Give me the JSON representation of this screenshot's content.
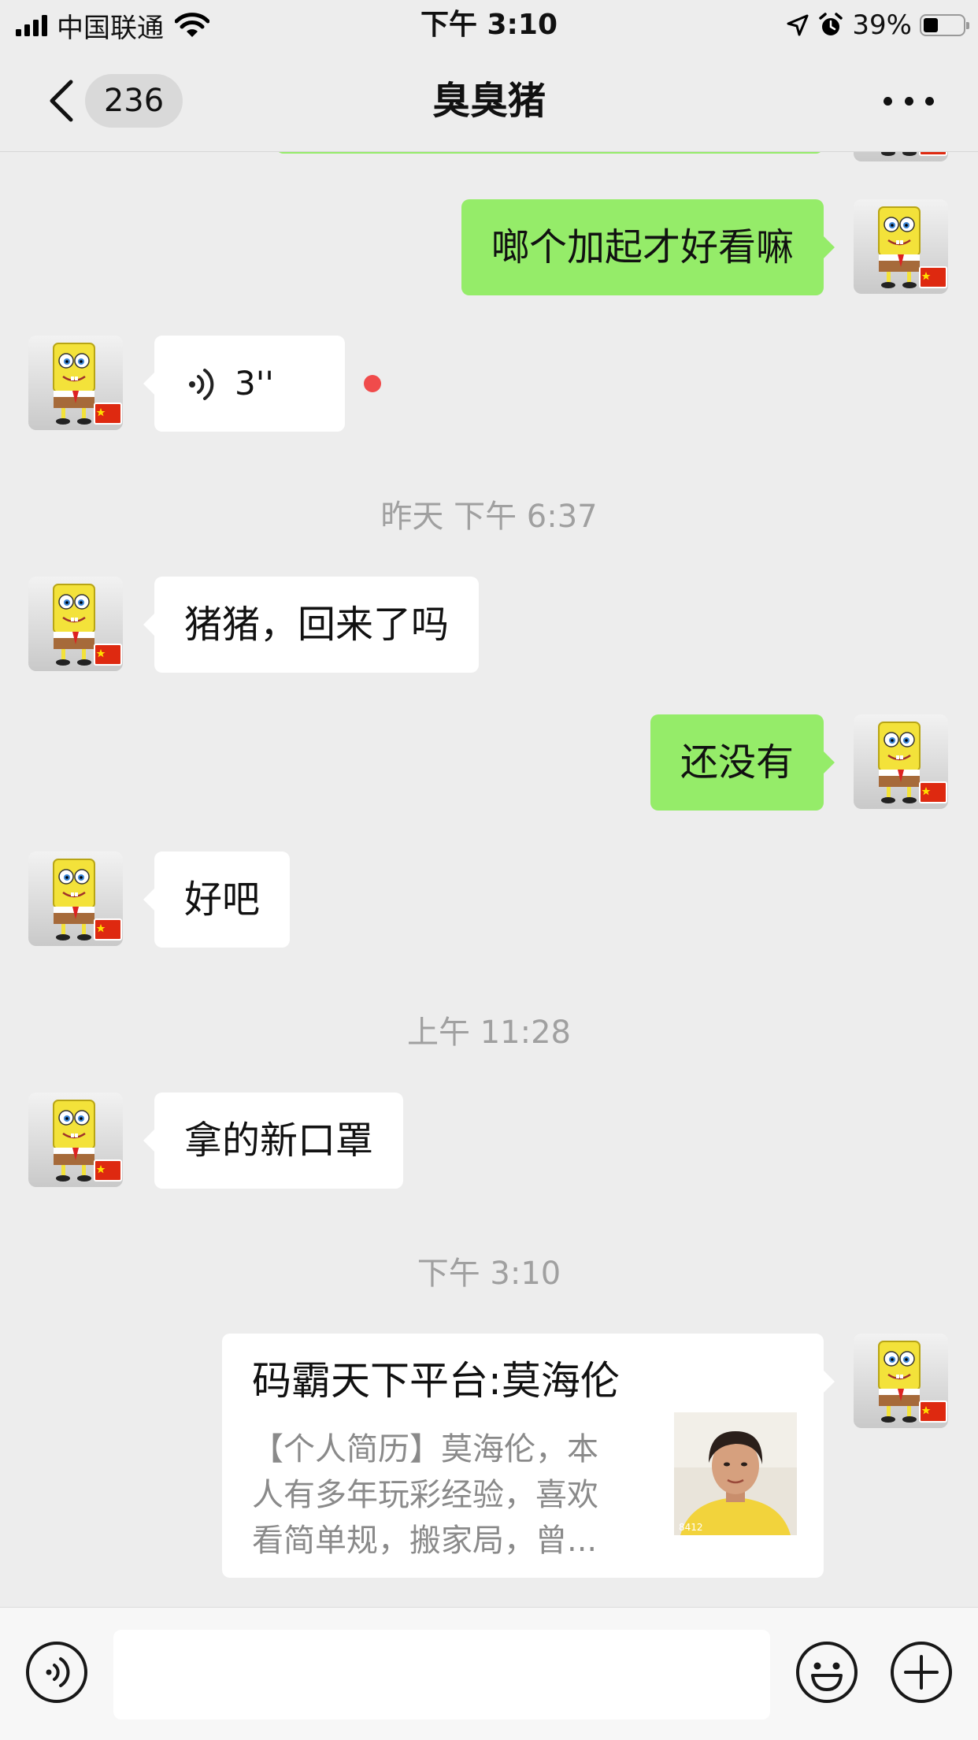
{
  "status_bar": {
    "carrier": "中国联通",
    "time": "下午 3:10",
    "battery_percent": "39%",
    "battery_level": 0.39
  },
  "nav": {
    "unread_count": "236",
    "title": "臭臭猪"
  },
  "messages": [
    {
      "type": "text",
      "direction": "out",
      "text": "啷个加起才好看嘛"
    },
    {
      "type": "voice",
      "direction": "in",
      "duration": "3''",
      "unread": true
    },
    {
      "type": "time",
      "text": "昨天 下午 6:37"
    },
    {
      "type": "text",
      "direction": "in",
      "text": "猪猪，回来了吗"
    },
    {
      "type": "text",
      "direction": "out",
      "text": "还没有"
    },
    {
      "type": "text",
      "direction": "in",
      "text": "好吧"
    },
    {
      "type": "time",
      "text": "上午 11:28"
    },
    {
      "type": "text",
      "direction": "in",
      "text": "拿的新口罩"
    },
    {
      "type": "time",
      "text": "下午 3:10"
    },
    {
      "type": "link-card",
      "direction": "out",
      "title": "码霸天下平台:莫海伦",
      "desc_lines": [
        "【个人简历】莫海伦，本",
        "人有多年玩彩经验，喜欢",
        "看简单规，搬家局，曾..."
      ],
      "thumb_caption": "8412"
    }
  ],
  "input": {
    "value": "",
    "placeholder": ""
  },
  "icons": {
    "back": "chevron-left-icon",
    "more": "more-dots-icon",
    "voice": "voice-icon",
    "emoji": "emoji-icon",
    "plus": "plus-icon"
  },
  "colors": {
    "outgoing_bubble": "#95ec69",
    "incoming_bubble": "#ffffff",
    "background": "#ededed",
    "unread_dot": "#f04b4b"
  }
}
